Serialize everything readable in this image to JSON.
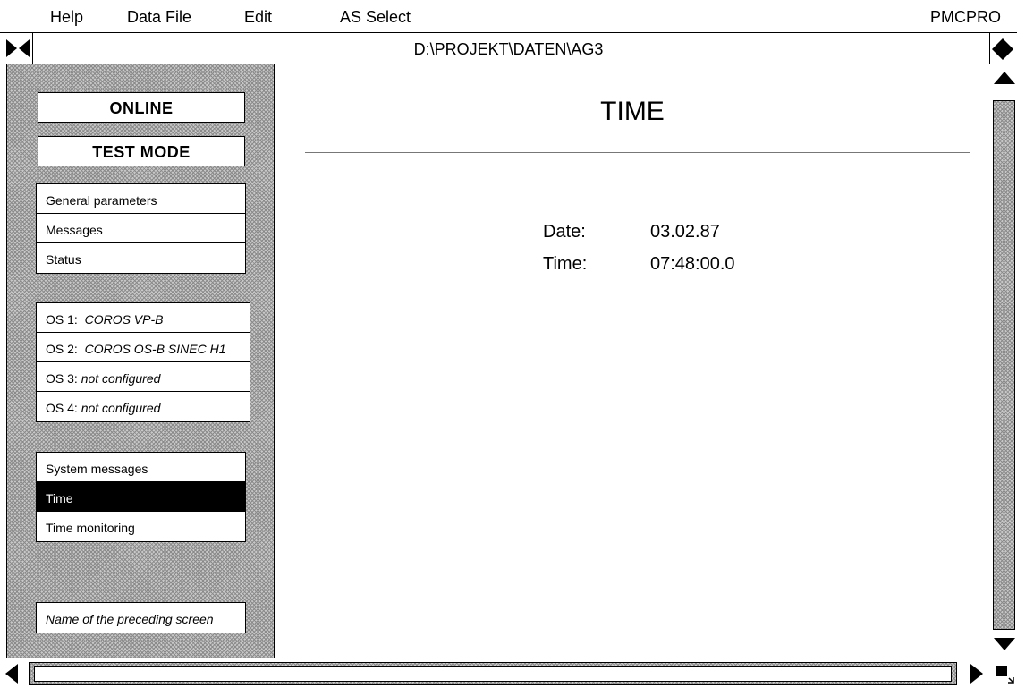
{
  "menu": {
    "help": "Help",
    "data_file": "Data File",
    "edit": "Edit",
    "as_select": "AS Select",
    "app_name": "PMCPRO"
  },
  "window": {
    "path": "D:\\PROJEKT\\DATEN\\AG3"
  },
  "sidebar": {
    "online": "ONLINE",
    "test_mode": "TEST MODE",
    "general": [
      "General parameters",
      "Messages",
      "Status"
    ],
    "os": [
      {
        "prefix": "OS 1:",
        "value": "COROS VP-B"
      },
      {
        "prefix": "OS 2:",
        "value": "COROS OS-B SINEC H1"
      },
      {
        "prefix": "OS 3:",
        "value": "not configured"
      },
      {
        "prefix": "OS 4:",
        "value": "not configured"
      }
    ],
    "system": [
      "System messages",
      "Time",
      "Time monitoring"
    ],
    "active_item": "Time",
    "preceding": "Name of the preceding screen"
  },
  "main": {
    "title": "TIME",
    "date_label": "Date:",
    "date_value": "03.02.87",
    "time_label": "Time:",
    "time_value": "07:48:00.0"
  },
  "icons": {
    "nav_left": "bowtie-icon",
    "nav_right": "diamond-icon",
    "scroll_up": "triangle-up-icon",
    "scroll_down": "triangle-down-icon",
    "scroll_left": "triangle-left-icon",
    "scroll_right": "triangle-right-icon",
    "resize": "resize-corner-icon"
  }
}
